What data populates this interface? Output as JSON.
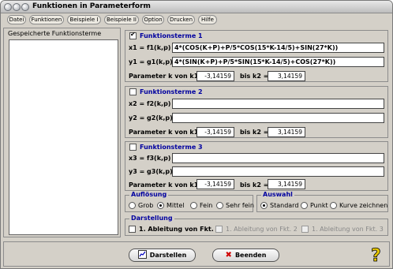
{
  "window": {
    "title": "Funktionen in Parameterform"
  },
  "menu": [
    "Datei",
    "Funktionen",
    "Beispiele I",
    "Beispiele II",
    "Option",
    "Drucken",
    "Hilfe"
  ],
  "left_panel": {
    "title": "Gespeicherte Funktionsterme"
  },
  "groups": [
    {
      "title": "Funktionsterme 1",
      "checked": true,
      "x_label": "x1 = f1(k,p) =",
      "x_value": "4*(COS(K+P)+P/5*COS(15*K-14/5)+SIN(27*K))",
      "y_label": "y1 = g1(k,p) =",
      "y_value": "4*(SIN(K+P)+P/5*SIN(15*K-14/5)+COS(27*K))",
      "k_label": "Parameter  k von k1 =",
      "k1": "-3,14159",
      "bis_label": "bis k2 =",
      "k2": "3,14159"
    },
    {
      "title": "Funktionsterme 2",
      "checked": false,
      "x_label": "x2 = f2(k,p) =",
      "x_value": "",
      "y_label": "y2 = g2(k,p) =",
      "y_value": "",
      "k_label": "Parameter  k von k1 =",
      "k1": "-3,14159",
      "bis_label": "bis k2 =",
      "k2": "3,14159"
    },
    {
      "title": "Funktionsterme 3",
      "checked": false,
      "x_label": "x3 = f3(k,p) =",
      "x_value": "",
      "y_label": "y3 = g3(k,p) =",
      "y_value": "",
      "k_label": "Parameter  k von k1 =",
      "k1": "-3,14159",
      "bis_label": "bis k2 =",
      "k2": "3,14159"
    }
  ],
  "aufloesung": {
    "title": "Auflösung",
    "options": [
      "Grob",
      "Mittel",
      "Fein",
      "Sehr fein"
    ],
    "selected": "Mittel"
  },
  "auswahl": {
    "title": "Auswahl",
    "options": [
      "Standard",
      "Punkt",
      "Kurve zeichnen"
    ],
    "selected": "Standard"
  },
  "darstellung": {
    "title": "Darstellung",
    "items": [
      "1. Ableitung von Fkt. 1",
      "1. Ableitung von Fkt. 2",
      "1. Ableitung von Fkt. 3"
    ]
  },
  "buttons": {
    "draw": "Darstellen",
    "quit": "Beenden"
  },
  "colors": {
    "group_title": "#0000a0",
    "help_icon": "#e8c800"
  }
}
